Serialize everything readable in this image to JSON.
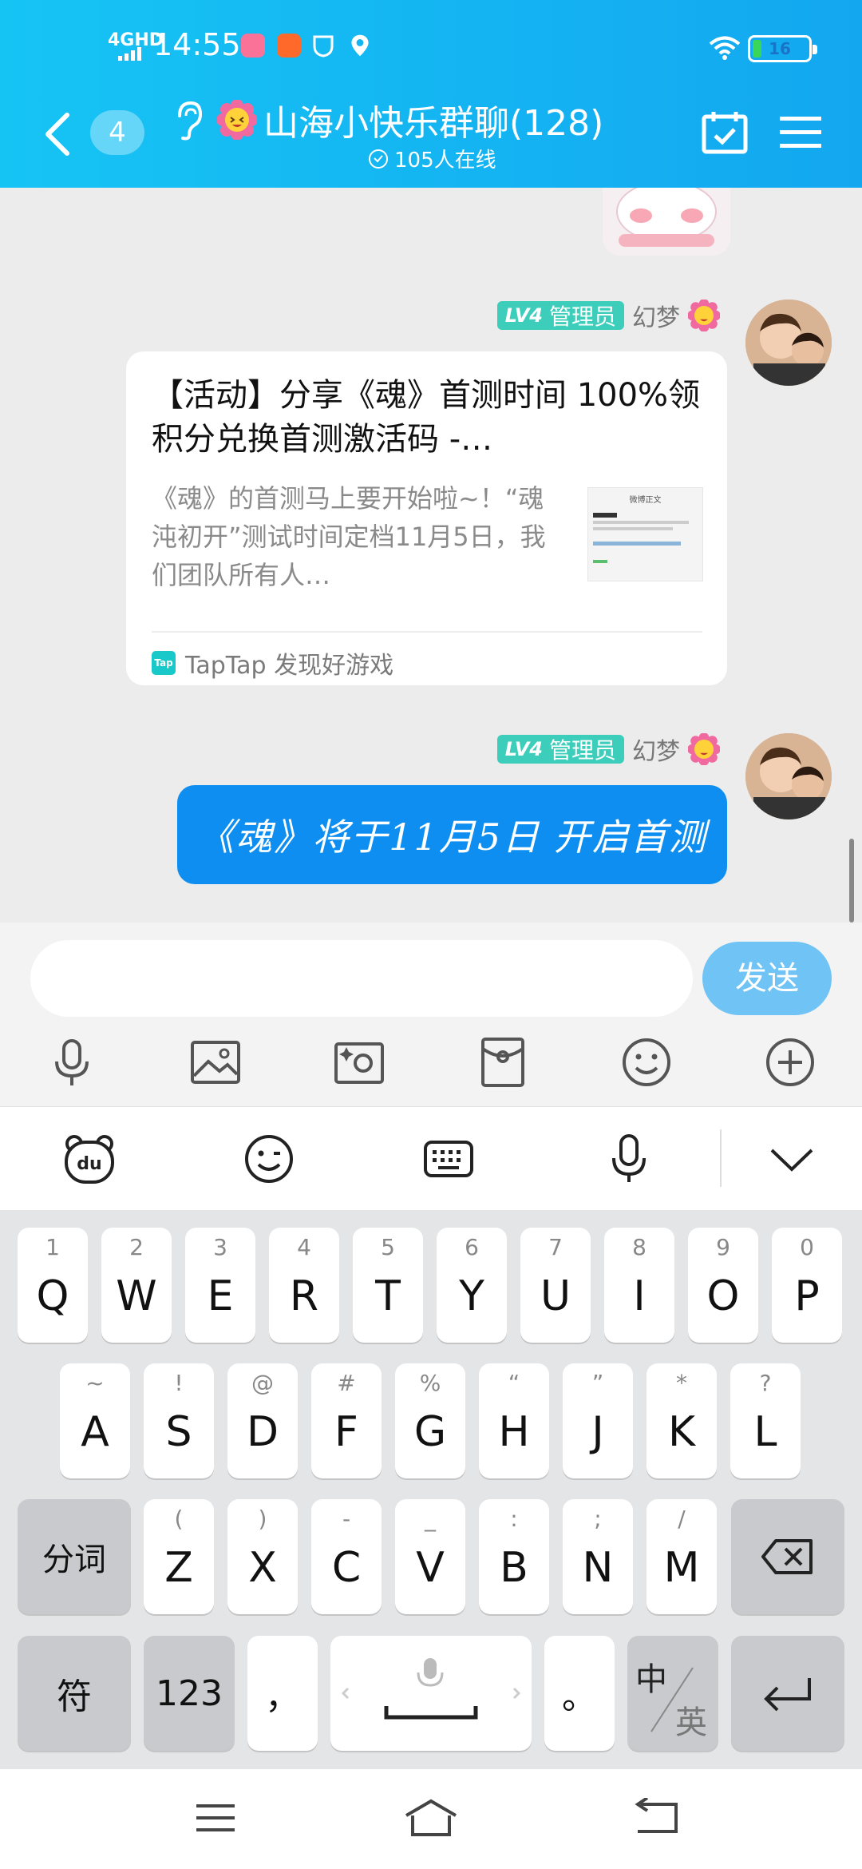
{
  "status_bar": {
    "network": "4GHD",
    "time": "14:55",
    "battery": "16",
    "battery_level": 16,
    "app_icons": [
      "bilibili-icon",
      "taobao-icon",
      "shield-icon",
      "location-icon"
    ]
  },
  "header": {
    "back_badge": "4",
    "title": "山海小快乐群聊(128)",
    "online": "105人在线"
  },
  "messages": [
    {
      "sender_level": "LV4",
      "sender_role": "管理员",
      "sender_name": "幻梦",
      "card": {
        "title": "【活动】分享《魂》首测时间 100%领积分兑换首测激活码 -…",
        "description": "《魂》的首测马上要开始啦~！“魂沌初开”测试时间定档11月5日，我们团队所有人…",
        "thumb_header": "微博正文",
        "source": "TapTap 发现好游戏",
        "source_logo": "Tap"
      }
    },
    {
      "sender_level": "LV4",
      "sender_role": "管理员",
      "sender_name": "幻梦",
      "text": "《魂》将于11月5日 开启首测"
    }
  ],
  "input": {
    "placeholder": "",
    "send_label": "发送"
  },
  "keyboard": {
    "row1": [
      {
        "sup": "1",
        "key": "Q"
      },
      {
        "sup": "2",
        "key": "W"
      },
      {
        "sup": "3",
        "key": "E"
      },
      {
        "sup": "4",
        "key": "R"
      },
      {
        "sup": "5",
        "key": "T"
      },
      {
        "sup": "6",
        "key": "Y"
      },
      {
        "sup": "7",
        "key": "U"
      },
      {
        "sup": "8",
        "key": "I"
      },
      {
        "sup": "9",
        "key": "O"
      },
      {
        "sup": "0",
        "key": "P"
      }
    ],
    "row2": [
      {
        "sup": "~",
        "key": "A"
      },
      {
        "sup": "!",
        "key": "S"
      },
      {
        "sup": "@",
        "key": "D"
      },
      {
        "sup": "#",
        "key": "F"
      },
      {
        "sup": "%",
        "key": "G"
      },
      {
        "sup": "“",
        "key": "H"
      },
      {
        "sup": "”",
        "key": "J"
      },
      {
        "sup": "*",
        "key": "K"
      },
      {
        "sup": "?",
        "key": "L"
      }
    ],
    "row3": [
      {
        "sup": "(",
        "key": "Z"
      },
      {
        "sup": ")",
        "key": "X"
      },
      {
        "sup": "-",
        "key": "C"
      },
      {
        "sup": "_",
        "key": "V"
      },
      {
        "sup": ":",
        "key": "B"
      },
      {
        "sup": ";",
        "key": "N"
      },
      {
        "sup": "/",
        "key": "M"
      }
    ],
    "segment": "分词",
    "symbols": "符",
    "numbers": "123",
    "comma": "，",
    "period": "。",
    "lang_top": "中",
    "lang_bottom": "英"
  }
}
